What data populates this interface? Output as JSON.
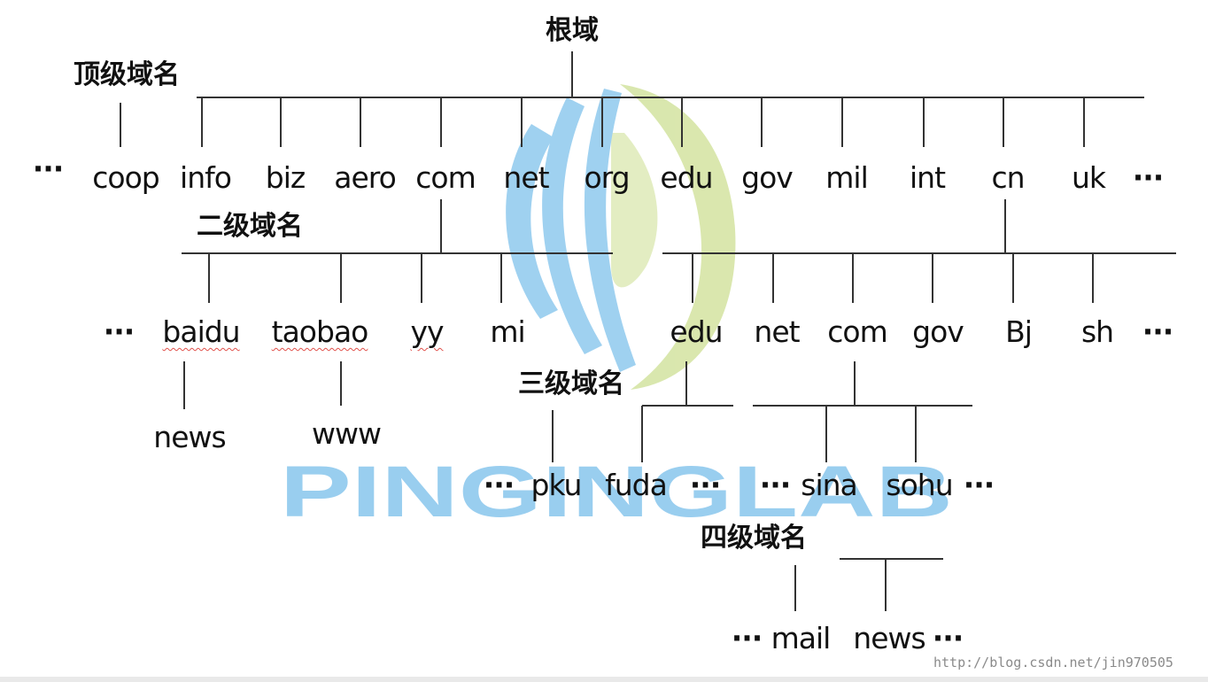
{
  "tiers": {
    "root": "根域",
    "top": "顶级域名",
    "second": "二级域名",
    "third": "三级域名",
    "fourth": "四级域名"
  },
  "top_level": [
    "coop",
    "info",
    "biz",
    "aero",
    "com",
    "net",
    "org",
    "edu",
    "gov",
    "mil",
    "int",
    "cn",
    "uk"
  ],
  "second_level_com": [
    "baidu",
    "taobao",
    "yy",
    "mi"
  ],
  "second_level_cn": [
    "edu",
    "net",
    "com",
    "gov",
    "Bj",
    "sh"
  ],
  "third_level": {
    "baidu_child": "news",
    "taobao_child": "www",
    "edu_children": [
      "pku",
      "fuda"
    ],
    "com_children": [
      "sina",
      "sohu"
    ]
  },
  "fourth_level": [
    "mail",
    "news"
  ],
  "ellipsis": "···",
  "watermark": {
    "text": "PINGINGLAB",
    "colors": {
      "blue": "#8fc9ee",
      "green": "#cfe29a"
    }
  },
  "footer_url": "http://blog.csdn.net/jin970505"
}
